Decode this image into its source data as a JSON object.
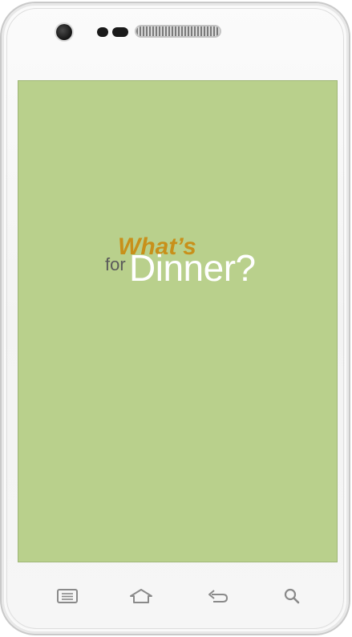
{
  "device": {
    "type": "android-phone",
    "screen_color": "#b9d08c"
  },
  "splash": {
    "logo_line1": "What’s",
    "logo_for": "for",
    "logo_line2": "Dinner?",
    "colors": {
      "whats": "#c8901a",
      "for": "#5a5a5a",
      "dinner": "#ffffff"
    }
  },
  "nav": {
    "buttons": [
      {
        "icon": "menu-icon"
      },
      {
        "icon": "home-icon"
      },
      {
        "icon": "back-icon"
      },
      {
        "icon": "search-icon"
      }
    ]
  }
}
